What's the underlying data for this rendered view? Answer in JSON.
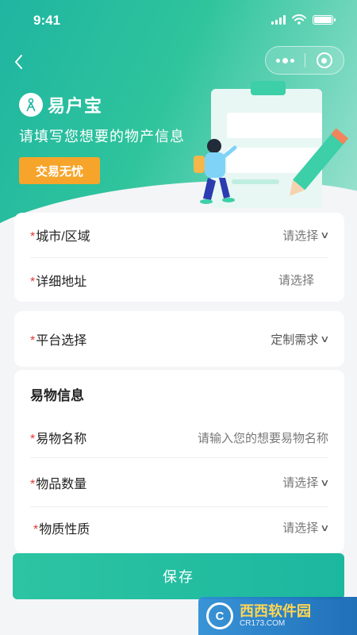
{
  "status_bar": {
    "time": "9:41"
  },
  "nav": {
    "back_icon": "back-chevron-icon",
    "more_icon": "more-dots-icon",
    "close_icon": "record-circle-icon"
  },
  "hero": {
    "brand_name": "易户宝",
    "tagline": "请填写您想要的物产信息",
    "badge_label": "交易无忧"
  },
  "location_card": {
    "rows": [
      {
        "label": "城市/区域",
        "value": "请选择",
        "has_chevron": true
      },
      {
        "label": "详细地址",
        "value": "请选择",
        "has_chevron": false
      }
    ]
  },
  "platform_card": {
    "rows": [
      {
        "label": "平台选择",
        "value": "定制需求",
        "has_chevron": true
      }
    ]
  },
  "item_card": {
    "title": "易物信息",
    "rows": [
      {
        "label": "易物名称",
        "value": "请输入您的想要易物名称",
        "has_chevron": false
      },
      {
        "label": "物品数量",
        "value": "请选择",
        "has_chevron": true
      },
      {
        "label": "物质性质",
        "value": "请选择",
        "has_chevron": true
      }
    ]
  },
  "save_label": "保存",
  "watermark": {
    "logo_text": "C",
    "main": "西西软件园",
    "sub": "CR173.COM"
  },
  "colors": {
    "primary": "#22bba0",
    "accent": "#f7a52a",
    "required": "#e53935"
  }
}
